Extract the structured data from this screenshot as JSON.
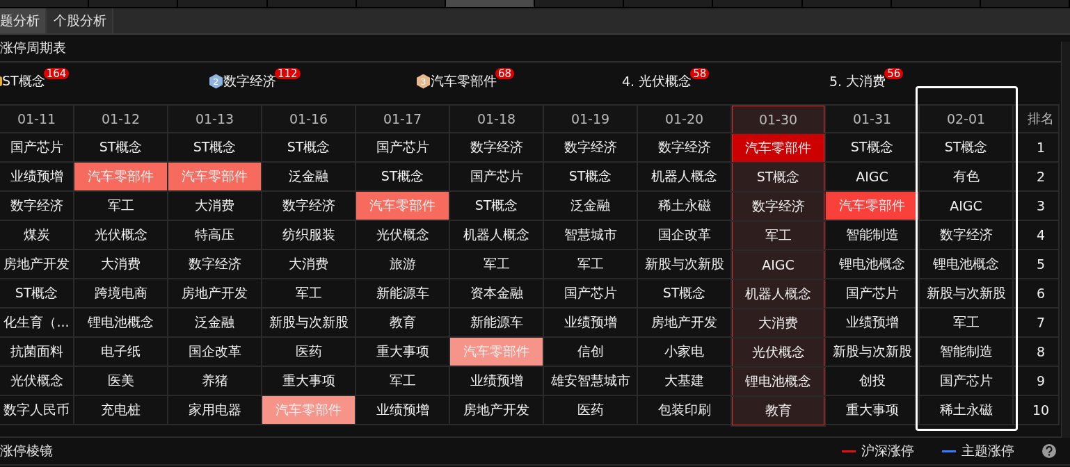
{
  "tabs": [
    {
      "label": "题分析",
      "selected": true
    },
    {
      "label": "个股分析",
      "selected": false
    }
  ],
  "section_title": "涨停周期表",
  "top_themes": [
    {
      "kind": "medal",
      "color": "#e8b030",
      "label": "ST概念",
      "count": "164"
    },
    {
      "kind": "medal",
      "color": "#8fb4e0",
      "medal_number": "2",
      "label": "数字经济",
      "count": "112"
    },
    {
      "kind": "medal",
      "color": "#e8b98c",
      "medal_number": "3",
      "label": "汽车零部件",
      "count": "68"
    },
    {
      "kind": "number",
      "prefix": "4.",
      "label": "光伏概念",
      "count": "58"
    },
    {
      "kind": "number",
      "prefix": "5.",
      "label": "大消费",
      "count": "56"
    }
  ],
  "table": {
    "columns": [
      {
        "date": "01-11",
        "selected": false,
        "cells": [
          {
            "text": "国产芯片"
          },
          {
            "text": "业绩预增"
          },
          {
            "text": "数字经济"
          },
          {
            "text": "煤炭"
          },
          {
            "text": "房地产开发"
          },
          {
            "text": "ST概念"
          },
          {
            "text": "化生育（..."
          },
          {
            "text": "抗菌面料"
          },
          {
            "text": "光伏概念"
          },
          {
            "text": "数字人民币"
          }
        ]
      },
      {
        "date": "01-12",
        "selected": false,
        "cells": [
          {
            "text": "ST概念"
          },
          {
            "text": "汽车零部件",
            "color": "#f76b5e"
          },
          {
            "text": "军工"
          },
          {
            "text": "光伏概念"
          },
          {
            "text": "大消费"
          },
          {
            "text": "跨境电商"
          },
          {
            "text": "锂电池概念"
          },
          {
            "text": "电子纸"
          },
          {
            "text": "医美"
          },
          {
            "text": "充电桩"
          }
        ]
      },
      {
        "date": "01-13",
        "selected": false,
        "cells": [
          {
            "text": "ST概念"
          },
          {
            "text": "汽车零部件",
            "color": "#f76b5e"
          },
          {
            "text": "大消费"
          },
          {
            "text": "特高压"
          },
          {
            "text": "数字经济"
          },
          {
            "text": "房地产开发"
          },
          {
            "text": "泛金融"
          },
          {
            "text": "国企改革"
          },
          {
            "text": "养猪"
          },
          {
            "text": "家用电器"
          }
        ]
      },
      {
        "date": "01-16",
        "selected": false,
        "cells": [
          {
            "text": "ST概念"
          },
          {
            "text": "泛金融"
          },
          {
            "text": "数字经济"
          },
          {
            "text": "纺织服装"
          },
          {
            "text": "大消费"
          },
          {
            "text": "军工"
          },
          {
            "text": "新股与次新股"
          },
          {
            "text": "医药"
          },
          {
            "text": "重大事项"
          },
          {
            "text": "汽车零部件",
            "color": "#f7948a"
          }
        ]
      },
      {
        "date": "01-17",
        "selected": false,
        "cells": [
          {
            "text": "国产芯片"
          },
          {
            "text": "ST概念"
          },
          {
            "text": "汽车零部件",
            "color": "#f76b5e"
          },
          {
            "text": "光伏概念"
          },
          {
            "text": "旅游"
          },
          {
            "text": "新能源车"
          },
          {
            "text": "教育"
          },
          {
            "text": "重大事项"
          },
          {
            "text": "军工"
          },
          {
            "text": "业绩预增"
          }
        ]
      },
      {
        "date": "01-18",
        "selected": false,
        "cells": [
          {
            "text": "数字经济"
          },
          {
            "text": "国产芯片"
          },
          {
            "text": "ST概念"
          },
          {
            "text": "机器人概念"
          },
          {
            "text": "军工"
          },
          {
            "text": "资本金融"
          },
          {
            "text": "新能源车"
          },
          {
            "text": "汽车零部件",
            "color": "#f7948a"
          },
          {
            "text": "业绩预增"
          },
          {
            "text": "房地产开发"
          }
        ]
      },
      {
        "date": "01-19",
        "selected": false,
        "cells": [
          {
            "text": "数字经济"
          },
          {
            "text": "ST概念"
          },
          {
            "text": "泛金融"
          },
          {
            "text": "智慧城市"
          },
          {
            "text": "军工"
          },
          {
            "text": "国产芯片"
          },
          {
            "text": "业绩预增"
          },
          {
            "text": "信创"
          },
          {
            "text": "雄安智慧城市"
          },
          {
            "text": "医药"
          }
        ]
      },
      {
        "date": "01-20",
        "selected": false,
        "cells": [
          {
            "text": "数字经济"
          },
          {
            "text": "机器人概念"
          },
          {
            "text": "稀土永磁"
          },
          {
            "text": "国企改革"
          },
          {
            "text": "新股与次新股"
          },
          {
            "text": "ST概念"
          },
          {
            "text": "房地产开发"
          },
          {
            "text": "小家电"
          },
          {
            "text": "大基建"
          },
          {
            "text": "包装印刷"
          }
        ]
      },
      {
        "date": "01-30",
        "selected": true,
        "cells": [
          {
            "text": "汽车零部件",
            "color": "#cc0000"
          },
          {
            "text": "ST概念"
          },
          {
            "text": "数字经济"
          },
          {
            "text": "军工"
          },
          {
            "text": "AIGC"
          },
          {
            "text": "机器人概念"
          },
          {
            "text": "大消费"
          },
          {
            "text": "光伏概念"
          },
          {
            "text": "锂电池概念"
          },
          {
            "text": "教育"
          }
        ]
      },
      {
        "date": "01-31",
        "selected": false,
        "cells": [
          {
            "text": "ST概念"
          },
          {
            "text": "AIGC"
          },
          {
            "text": "汽车零部件",
            "color": "#f9403a"
          },
          {
            "text": "智能制造"
          },
          {
            "text": "锂电池概念"
          },
          {
            "text": "国产芯片"
          },
          {
            "text": "业绩预增"
          },
          {
            "text": "新股与次新股"
          },
          {
            "text": "创投"
          },
          {
            "text": "重大事项"
          }
        ]
      },
      {
        "date": "02-01",
        "selected": false,
        "cells": [
          {
            "text": "ST概念"
          },
          {
            "text": "有色"
          },
          {
            "text": "AIGC"
          },
          {
            "text": "数字经济"
          },
          {
            "text": "锂电池概念"
          },
          {
            "text": "新股与次新股"
          },
          {
            "text": "军工"
          },
          {
            "text": "智能制造"
          },
          {
            "text": "国产芯片"
          },
          {
            "text": "稀土永磁"
          }
        ]
      }
    ],
    "rank_header": "排名",
    "ranks": [
      "1",
      "2",
      "3",
      "4",
      "5",
      "6",
      "7",
      "8",
      "9",
      "10"
    ]
  },
  "footer": {
    "title": "涨停棱镜",
    "legend": [
      {
        "label": "沪深涨停",
        "color": "#e01010"
      },
      {
        "label": "主题涨停",
        "color": "#3b7cff"
      }
    ]
  }
}
